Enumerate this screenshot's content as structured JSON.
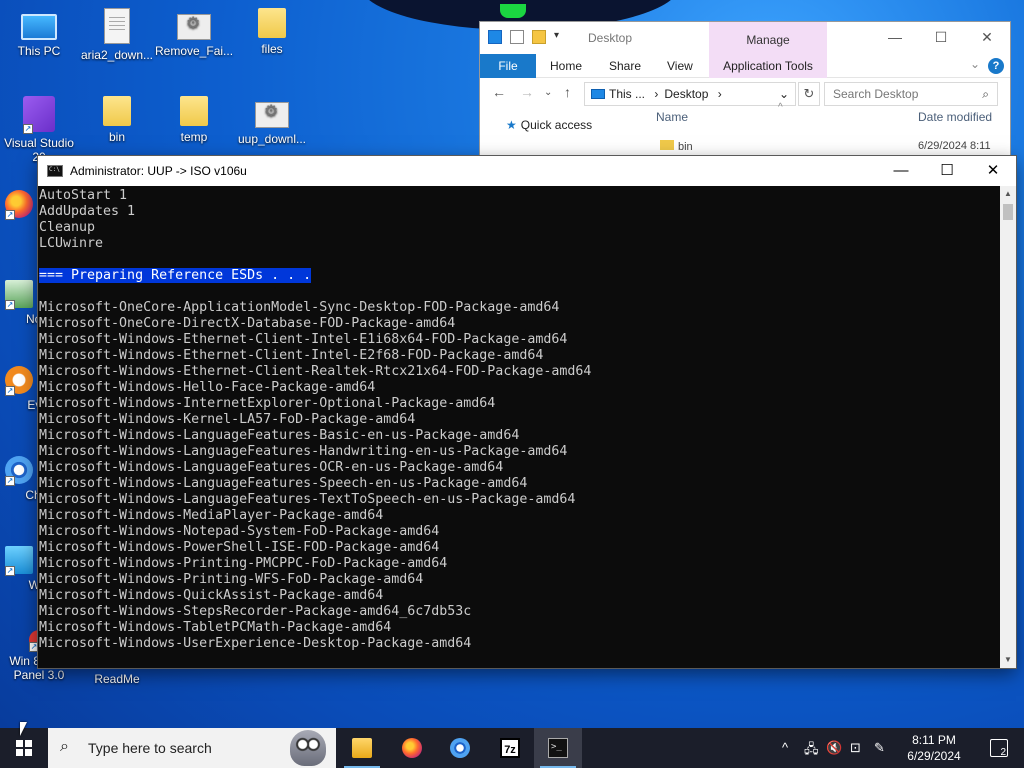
{
  "desktop": {
    "icons": [
      {
        "label": "This PC"
      },
      {
        "label": "aria2_down..."
      },
      {
        "label": "Remove_Fai..."
      },
      {
        "label": "files"
      },
      {
        "label": "Visual Studio 20"
      },
      {
        "label": "bin"
      },
      {
        "label": "temp"
      },
      {
        "label": "uup_downl..."
      },
      {
        "label": "Fire"
      },
      {
        "label": "Notep"
      },
      {
        "label": "Every"
      },
      {
        "label": "Chron"
      },
      {
        "label": "WinN"
      },
      {
        "label": "Win 8 Start Panel 3.0"
      },
      {
        "label": "ReadMe"
      }
    ]
  },
  "explorer": {
    "title": "Desktop",
    "manage_label": "Manage",
    "tabs": {
      "file": "File",
      "home": "Home",
      "share": "Share",
      "view": "View",
      "app_tools": "Application Tools"
    },
    "address": {
      "part1": "This ...",
      "sep": "›",
      "part2": "Desktop",
      "sep2": "›"
    },
    "search_placeholder": "Search Desktop",
    "quick_access": "Quick access",
    "columns": {
      "name": "Name",
      "date": "Date modified"
    },
    "row": {
      "name": "bin",
      "date": "6/29/2024 8:11"
    }
  },
  "console": {
    "title": "Administrator:  UUP -> ISO v106u",
    "lines": [
      "AutoStart 1",
      "AddUpdates 1",
      "Cleanup",
      "LCUwinre",
      "",
      "=== Preparing Reference ESDs . . .",
      "",
      "Microsoft-OneCore-ApplicationModel-Sync-Desktop-FOD-Package-amd64",
      "Microsoft-OneCore-DirectX-Database-FOD-Package-amd64",
      "Microsoft-Windows-Ethernet-Client-Intel-E1i68x64-FOD-Package-amd64",
      "Microsoft-Windows-Ethernet-Client-Intel-E2f68-FOD-Package-amd64",
      "Microsoft-Windows-Ethernet-Client-Realtek-Rtcx21x64-FOD-Package-amd64",
      "Microsoft-Windows-Hello-Face-Package-amd64",
      "Microsoft-Windows-InternetExplorer-Optional-Package-amd64",
      "Microsoft-Windows-Kernel-LA57-FoD-Package-amd64",
      "Microsoft-Windows-LanguageFeatures-Basic-en-us-Package-amd64",
      "Microsoft-Windows-LanguageFeatures-Handwriting-en-us-Package-amd64",
      "Microsoft-Windows-LanguageFeatures-OCR-en-us-Package-amd64",
      "Microsoft-Windows-LanguageFeatures-Speech-en-us-Package-amd64",
      "Microsoft-Windows-LanguageFeatures-TextToSpeech-en-us-Package-amd64",
      "Microsoft-Windows-MediaPlayer-Package-amd64",
      "Microsoft-Windows-Notepad-System-FoD-Package-amd64",
      "Microsoft-Windows-PowerShell-ISE-FOD-Package-amd64",
      "Microsoft-Windows-Printing-PMCPPC-FoD-Package-amd64",
      "Microsoft-Windows-Printing-WFS-FoD-Package-amd64",
      "Microsoft-Windows-QuickAssist-Package-amd64",
      "Microsoft-Windows-StepsRecorder-Package-amd64_6c7db53c",
      "Microsoft-Windows-TabletPCMath-Package-amd64",
      "Microsoft-Windows-UserExperience-Desktop-Package-amd64"
    ],
    "highlight_index": 5
  },
  "taskbar": {
    "search_placeholder": "Type here to search",
    "apps": [
      {
        "name": "file-explorer"
      },
      {
        "name": "firefox"
      },
      {
        "name": "chromium"
      },
      {
        "name": "7-zip",
        "label": "7z"
      },
      {
        "name": "command-prompt"
      }
    ],
    "clock": {
      "time": "8:11 PM",
      "date": "6/29/2024"
    },
    "notification_count": "2"
  },
  "colors": {
    "console_bg": "#0c0c0c",
    "console_text": "#cccccc",
    "highlight": "#0037da",
    "taskbar": "#1b1e2a",
    "explorer_file_tab": "#1979ca",
    "manage_tab": "#f3ddf6"
  }
}
